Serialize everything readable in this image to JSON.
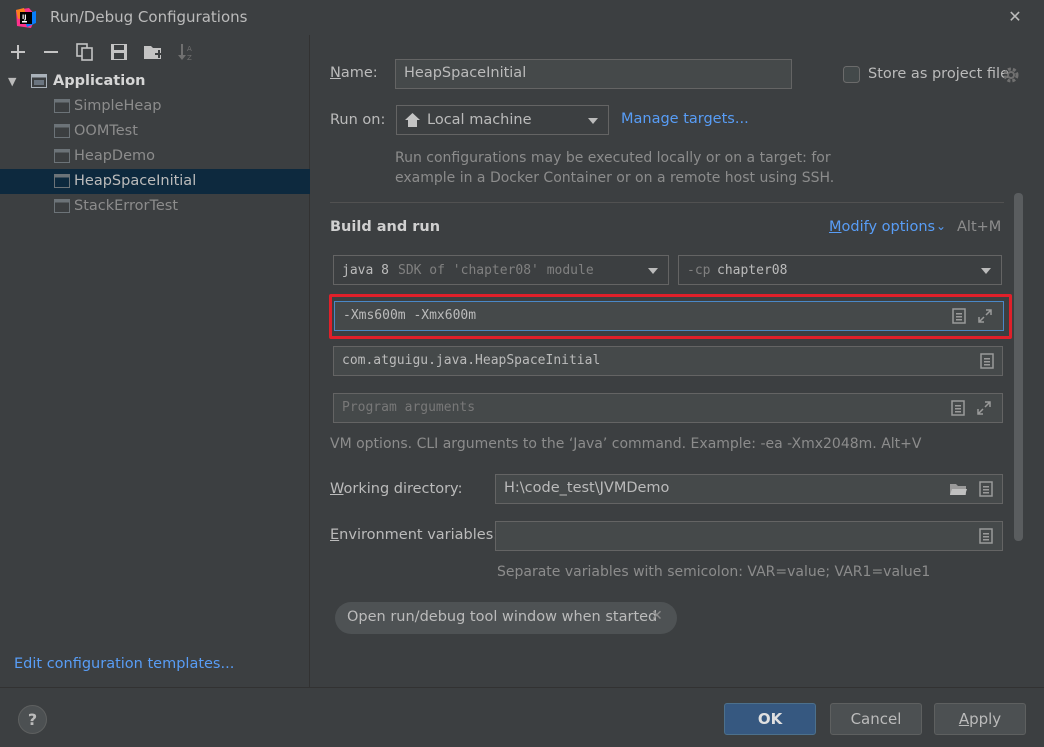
{
  "window": {
    "title": "Run/Debug Configurations"
  },
  "tree": {
    "root": "Application",
    "items": [
      "SimpleHeap",
      "OOMTest",
      "HeapDemo",
      "HeapSpaceInitial",
      "StackErrorTest"
    ],
    "selected": "HeapSpaceInitial"
  },
  "left_footer": {
    "edit_templates": "Edit configuration templates..."
  },
  "form": {
    "name_label_first": "N",
    "name_label_rest": "ame:",
    "name_value": "HeapSpaceInitial",
    "store_label": "Store as project file",
    "run_on_label": "Run on:",
    "run_on_value": "Local machine",
    "manage_targets": "Manage targets...",
    "run_on_hint_line1": "Run configurations may be executed locally or on a target: for",
    "run_on_hint_line2": "example in a Docker Container or on a remote host using SSH.",
    "section_title": "Build and run",
    "modify_options_first": "M",
    "modify_options_rest": "odify options",
    "modify_shortcut": "Alt+M",
    "sdk_java": "java 8",
    "sdk_detail": "SDK of 'chapter08' module",
    "cp_prefix": "-cp",
    "cp_value": "chapter08",
    "vm_options": "-Xms600m -Xmx600m",
    "main_class": "com.atguigu.java.HeapSpaceInitial",
    "program_args_placeholder": "Program arguments",
    "vm_hint": "VM options. CLI arguments to the ‘Java’ command. Example: -ea -Xmx2048m. Alt+V",
    "workdir_label_first": "W",
    "workdir_label_rest": "orking directory:",
    "workdir_value": "H:\\code_test\\JVMDemo",
    "env_label_first": "E",
    "env_label_rest": "nvironment variables:",
    "env_value": "",
    "env_hint": "Separate variables with semicolon: VAR=value; VAR1=value1",
    "open_tool_window_tag": "Open run/debug tool window when started"
  },
  "buttons": {
    "help": "?",
    "ok": "OK",
    "cancel": "Cancel",
    "apply_first": "A",
    "apply_rest": "pply"
  },
  "colors": {
    "background": "#3c3f41",
    "selection": "#0d293e",
    "link": "#589df6",
    "highlight": "#e0202a",
    "primary_button": "#365880"
  }
}
